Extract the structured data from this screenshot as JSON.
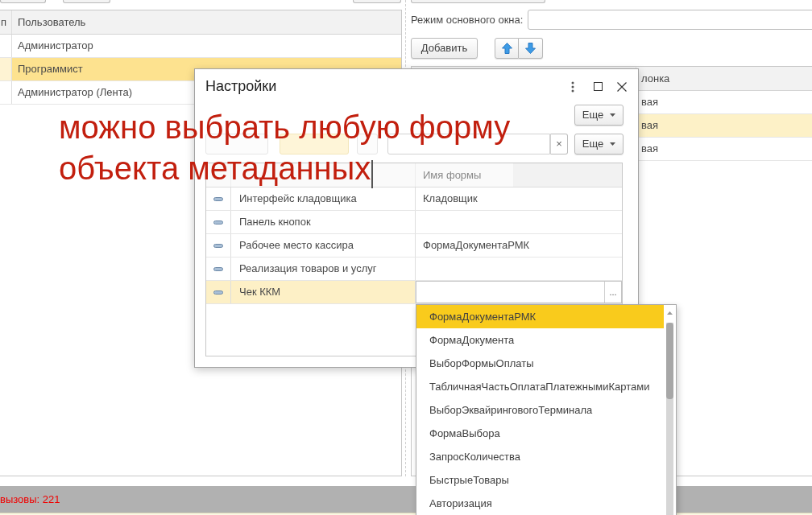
{
  "users_table": {
    "columns": [
      "п",
      "Пользователь"
    ],
    "rows": [
      {
        "user": "Администратор",
        "selected": false
      },
      {
        "user": "Программист",
        "selected": true
      },
      {
        "user": "Администратор (Лента)",
        "selected": false
      }
    ]
  },
  "window_mode": {
    "label": "Режим основного окна:"
  },
  "columns_toolbar": {
    "add_button": "Добавить"
  },
  "columns_table": {
    "column_2": "лонка",
    "rows": [
      {
        "column_2": "вая",
        "selected": false
      },
      {
        "column_2": "вая",
        "selected": true
      },
      {
        "column_2": "вая",
        "selected": false
      }
    ]
  },
  "settings_dialog": {
    "title": "Настройки",
    "more_button": "Еще",
    "clear_button": "×",
    "list_more_button": "Еще",
    "form_name_header": "Имя формы",
    "rows": [
      {
        "name": "Интерфейс кладовщика",
        "form_name": "Кладовщик",
        "selected": false
      },
      {
        "name": "Панель кнопок",
        "selected": false
      },
      {
        "name": "Рабочее место кассира",
        "form_name": "ФормаДокументаРМК",
        "selected": false
      },
      {
        "name": "Реализация товаров и услуг",
        "selected": false
      },
      {
        "name": "Чек ККМ",
        "selected": true
      }
    ],
    "choice_button": "..."
  },
  "annotation": {
    "lines": [
      "можно выбрать любую форму",
      "объекта метаданных"
    ]
  },
  "form_dropdown": {
    "items": [
      {
        "label": "ФормаДокументаРМК",
        "selected": true
      },
      {
        "label": "ФормаДокумента",
        "selected": false
      },
      {
        "label": "ВыборФормыОплаты",
        "selected": false
      },
      {
        "label": "ТабличнаяЧастьОплатаПлатежнымиКартами",
        "selected": false
      },
      {
        "label": "ВыборЭквайринговогоТерминала",
        "selected": false
      },
      {
        "label": "ФормаВыбора",
        "selected": false
      },
      {
        "label": "ЗапросКоличества",
        "selected": false
      },
      {
        "label": "БыстрыеТовары",
        "selected": false
      },
      {
        "label": "Авторизация",
        "selected": false
      }
    ]
  },
  "status_bar": {
    "text": "вызовы: 221"
  }
}
